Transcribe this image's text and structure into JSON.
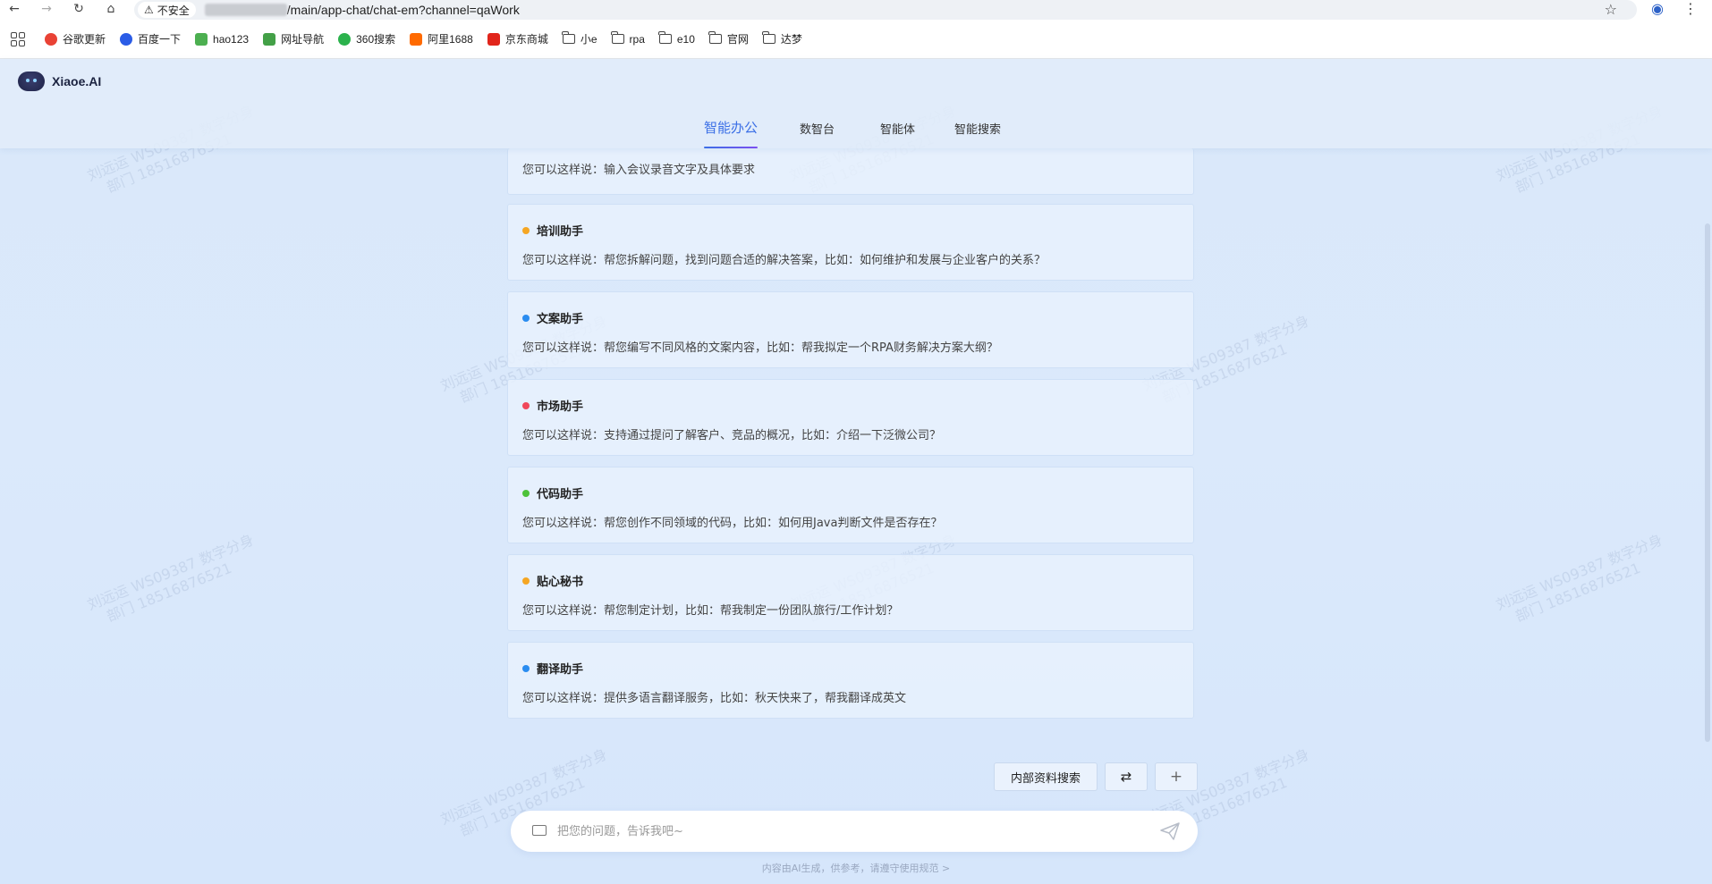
{
  "browser": {
    "insecure_label": "不安全",
    "url_path": "/main/app-chat/chat-em?channel=qaWork",
    "bookmarks": [
      {
        "label": "谷歌更新",
        "color": "#e94235"
      },
      {
        "label": "百度一下",
        "color": "#2b5ce6"
      },
      {
        "label": "hao123",
        "color": "#4caf50"
      },
      {
        "label": "网址导航",
        "color": "#43a047"
      },
      {
        "label": "360搜索",
        "color": "#2bb24c"
      },
      {
        "label": "阿里1688",
        "color": "#ff6a00"
      },
      {
        "label": "京东商城",
        "color": "#e1251b"
      },
      {
        "label": "小e",
        "folder": true
      },
      {
        "label": "rpa",
        "folder": true
      },
      {
        "label": "e10",
        "folder": true
      },
      {
        "label": "官网",
        "folder": true
      },
      {
        "label": "达梦",
        "folder": true
      }
    ]
  },
  "app": {
    "logo": "Xiaoe.AI",
    "tabs": [
      "智能办公",
      "数智台",
      "智能体",
      "智能搜索"
    ],
    "active_tab": "智能办公"
  },
  "cards": [
    {
      "title": "",
      "desc": "您可以这样说：输入会议录音文字及具体要求",
      "color": ""
    },
    {
      "title": "培训助手",
      "desc": "您可以这样说：帮您拆解问题，找到问题合适的解决答案，比如：如何维护和发展与企业客户的关系？",
      "color": "#f5a623"
    },
    {
      "title": "文案助手",
      "desc": "您可以这样说：帮您编写不同风格的文案内容，比如：帮我拟定一个RPA财务解决方案大纲？",
      "color": "#2a8cf0"
    },
    {
      "title": "市场助手",
      "desc": "您可以这样说：支持通过提问了解客户、竞品的概况，比如：介绍一下泛微公司？",
      "color": "#f0475a"
    },
    {
      "title": "代码助手",
      "desc": "您可以这样说：帮您创作不同领域的代码，比如：如何用Java判断文件是否存在？",
      "color": "#4cc23a"
    },
    {
      "title": "贴心秘书",
      "desc": "您可以这样说：帮您制定计划，比如：帮我制定一份团队旅行/工作计划？",
      "color": "#f5a623"
    },
    {
      "title": "翻译助手",
      "desc": "您可以这样说：提供多语言翻译服务，比如：秋天快来了，帮我翻译成英文",
      "color": "#2a8cf0"
    }
  ],
  "actions": {
    "internal_search": "内部资料搜索",
    "switch_symbol": "⇄",
    "add_symbol": "+"
  },
  "input": {
    "placeholder": "把您的问题，告诉我吧~",
    "value": ""
  },
  "footer": "内容由AI生成，供参考，请遵守使用规范 >",
  "watermark": {
    "line1": "刘远运 WS09387 数字分身",
    "line2": "部门 18516876521"
  }
}
